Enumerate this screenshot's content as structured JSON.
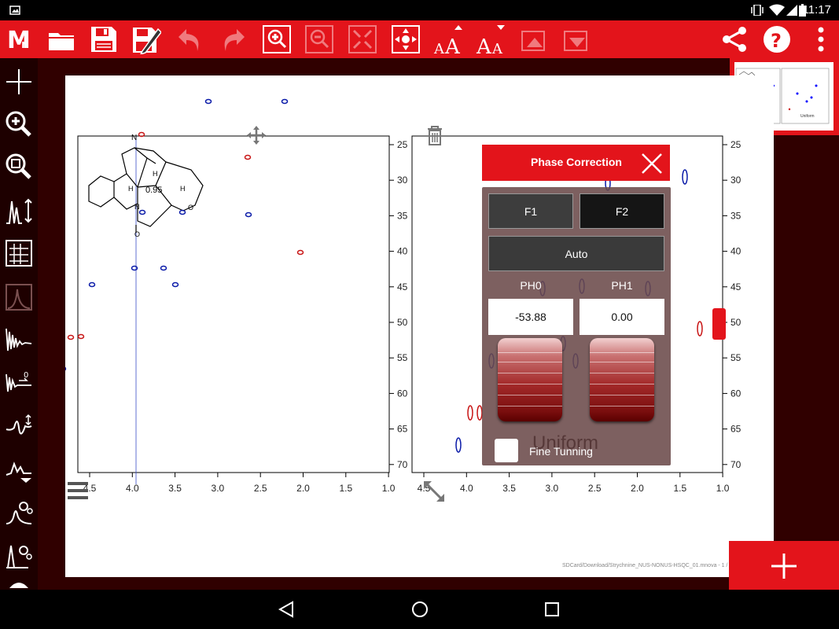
{
  "status_bar": {
    "time": "11:17"
  },
  "toolbar": {
    "icons": [
      "mnova-logo-icon",
      "open-folder-icon",
      "save-icon",
      "save-as-icon",
      "undo-icon",
      "redo-icon",
      "zoom-in-icon",
      "zoom-out-icon",
      "fit-all-icon",
      "pan-icon",
      "font-increase-icon",
      "font-decrease-icon",
      "layer-up-icon",
      "layer-down-icon",
      "share-icon",
      "help-icon",
      "overflow-menu-icon"
    ]
  },
  "sidebar": {
    "icons": [
      "crosshair-icon",
      "zoom-tool-icon",
      "fit-zoom-icon",
      "vertical-scale-icon",
      "peak-picking-icon",
      "spectrum-display-icon",
      "fid-icon",
      "zero-fill-icon",
      "phase-icon",
      "baseline-icon",
      "processing-settings-icon",
      "auto-process-icon",
      "more-tools-icon"
    ]
  },
  "plot_left": {
    "x_ticks": [
      "4.5",
      "4.0",
      "3.5",
      "3.0",
      "2.5",
      "2.0",
      "1.5",
      "1.0"
    ],
    "y_ticks": [
      "25",
      "30",
      "35",
      "40",
      "45",
      "50",
      "55",
      "60",
      "65",
      "70"
    ],
    "molecule_label": "0.95"
  },
  "plot_right": {
    "x_ticks": [
      "4.5",
      "4.0",
      "3.5",
      "3.0",
      "2.5",
      "2.0",
      "1.5",
      "1.0"
    ],
    "y_ticks": [
      "25",
      "30",
      "35",
      "40",
      "45",
      "50",
      "55",
      "60",
      "65",
      "70"
    ]
  },
  "phase_panel": {
    "title": "Phase Correction",
    "f1_label": "F1",
    "f2_label": "F2",
    "auto_label": "Auto",
    "ph0_label": "PH0",
    "ph1_label": "PH1",
    "ph0_value": "-53.88",
    "ph1_value": "0.00",
    "fine_tuning_label": "Fine Tunning",
    "ghost_text": "Uniform"
  },
  "thumbnail": {
    "caption": "Uniform"
  },
  "file_path": "SDCard/Download/Strychnine_NUS-NONUS-HSQC_01.mnova - 1 /",
  "colors": {
    "accent": "#e3141b",
    "positive_peak": "#0a1aa8",
    "negative_peak": "#c81414"
  }
}
